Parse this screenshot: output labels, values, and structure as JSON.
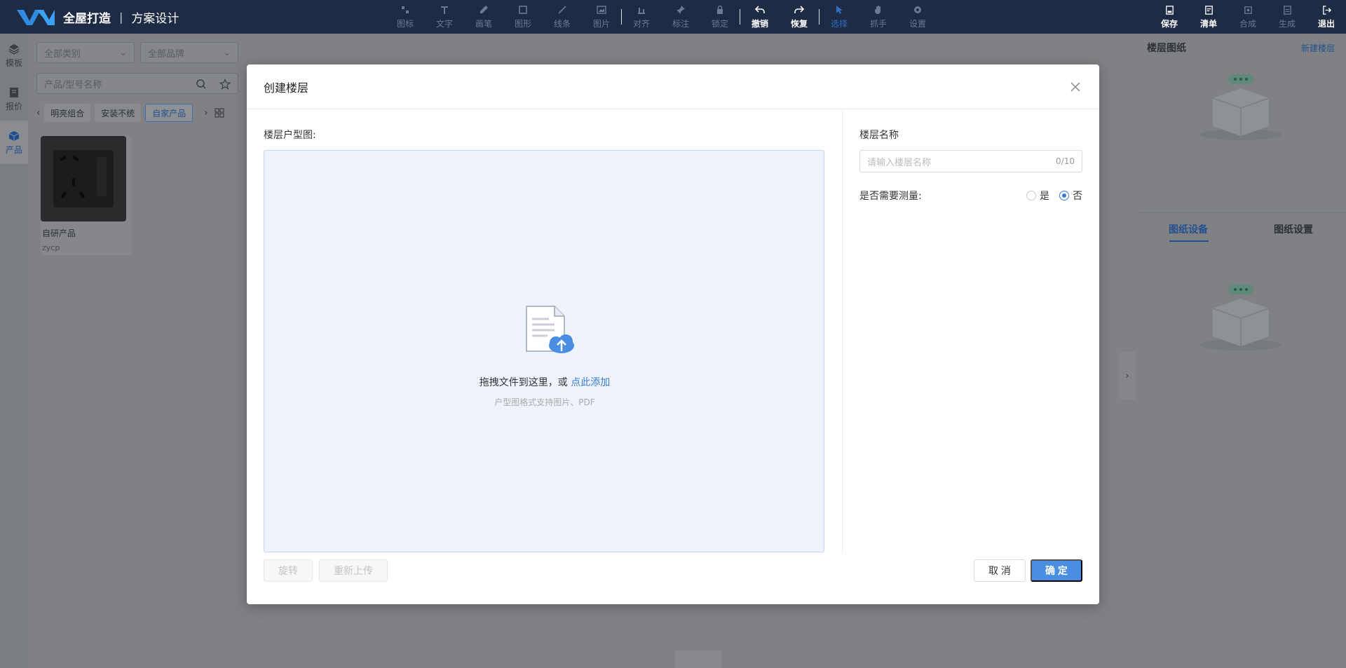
{
  "brand": {
    "name": "全屋打造",
    "separator": "|",
    "sub": "方案设计"
  },
  "toolbar": {
    "tools": [
      {
        "label": "图标",
        "icon": "icon-tool-icon"
      },
      {
        "label": "文字",
        "icon": "text-icon"
      },
      {
        "label": "画笔",
        "icon": "brush-icon"
      },
      {
        "label": "图形",
        "icon": "shape-icon"
      },
      {
        "label": "线条",
        "icon": "line-icon"
      },
      {
        "label": "图片",
        "icon": "image-icon"
      },
      {
        "label": "对齐",
        "icon": "align-icon"
      },
      {
        "label": "标注",
        "icon": "pin-icon"
      },
      {
        "label": "锁定",
        "icon": "lock-icon"
      },
      {
        "label": "撤销",
        "icon": "undo-icon"
      },
      {
        "label": "恢复",
        "icon": "redo-icon"
      },
      {
        "label": "选择",
        "icon": "cursor-icon"
      },
      {
        "label": "抓手",
        "icon": "hand-icon"
      },
      {
        "label": "设置",
        "icon": "gear-icon"
      }
    ],
    "right": [
      {
        "label": "保存",
        "icon": "save-icon"
      },
      {
        "label": "清单",
        "icon": "list-icon"
      },
      {
        "label": "合成",
        "icon": "compose-icon"
      },
      {
        "label": "生成",
        "icon": "generate-icon"
      },
      {
        "label": "退出",
        "icon": "exit-icon"
      }
    ]
  },
  "rail": [
    {
      "label": "模板",
      "icon": "layers-icon"
    },
    {
      "label": "报价",
      "icon": "quote-icon"
    },
    {
      "label": "产品",
      "icon": "cube-icon"
    }
  ],
  "left_panel": {
    "category_select": "全部类别",
    "brand_select": "全部品牌",
    "search_placeholder": "产品/型号名称",
    "chips": [
      "明亮组合",
      "安装不统",
      "自家产品"
    ],
    "product": {
      "name": "自研产品",
      "code": "zycp"
    }
  },
  "right_panel": {
    "title": "楼层图纸",
    "new_floor": "新建楼层",
    "tabs": [
      "图纸设备",
      "图纸设置"
    ]
  },
  "modal": {
    "title": "创建楼层",
    "upload_label": "楼层户型图:",
    "drop_text": "拖拽文件到这里，或",
    "drop_link": "点此添加",
    "drop_hint": "户型图格式支持图片、PDF",
    "name_label": "楼层名称",
    "name_placeholder": "请输入楼层名称",
    "name_count": "0/10",
    "measure_label": "是否需要测量:",
    "measure_yes": "是",
    "measure_no": "否",
    "rotate": "旋转",
    "reupload": "重新上传",
    "cancel": "取 消",
    "ok": "确 定"
  },
  "colors": {
    "topbar": "#1e2b45",
    "accent": "#4a8ee2",
    "dropzone": "#eef3fc"
  }
}
